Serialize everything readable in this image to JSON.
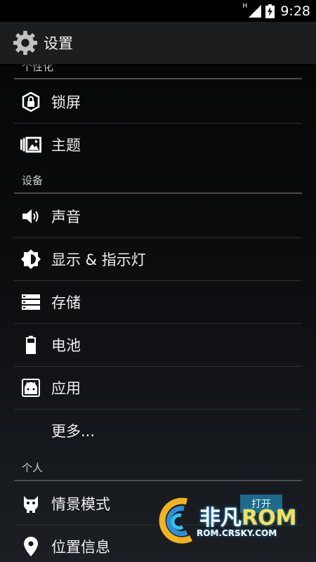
{
  "status_bar": {
    "network_type": "H",
    "time": "9:28",
    "icons": [
      "signal-icon",
      "battery-charging-icon"
    ]
  },
  "action_bar": {
    "title": "设置",
    "icon": "gear-icon"
  },
  "sections": [
    {
      "header": "个性化",
      "items": [
        {
          "label": "锁屏",
          "icon": "lock-icon"
        },
        {
          "label": "主题",
          "icon": "theme-icon"
        }
      ]
    },
    {
      "header": "设备",
      "items": [
        {
          "label": "声音",
          "icon": "speaker-icon"
        },
        {
          "label": "显示 & 指示灯",
          "icon": "brightness-icon"
        },
        {
          "label": "存储",
          "icon": "storage-icon"
        },
        {
          "label": "电池",
          "icon": "battery-icon"
        },
        {
          "label": "应用",
          "icon": "apps-icon"
        },
        {
          "label": "更多...",
          "icon": ""
        }
      ]
    },
    {
      "header": "个人",
      "items": [
        {
          "label": "情景模式",
          "icon": "profile-icon",
          "toggle": "打开"
        },
        {
          "label": "位置信息",
          "icon": "location-icon"
        }
      ]
    }
  ],
  "watermark": {
    "line1_a": "非凡",
    "line1_b": "ROM",
    "line2": "ROM.CRSKY.COM"
  },
  "colors": {
    "accent": "#1c6a8a",
    "action_bar": "#1c1d1f",
    "divider": "#2e3032",
    "header_rule": "#4a4c4e"
  }
}
